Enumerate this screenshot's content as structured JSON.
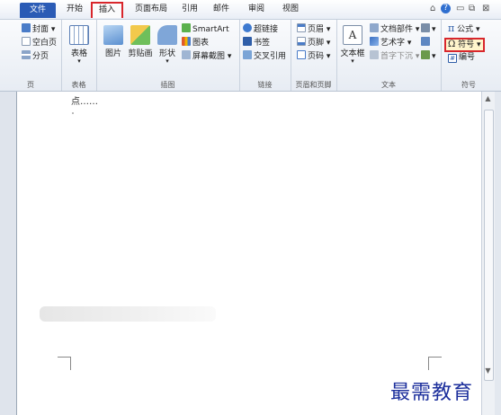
{
  "tabs": {
    "file": "文件",
    "home": "开始",
    "insert": "插入",
    "layout": "页面布局",
    "references": "引用",
    "mailings": "邮件",
    "review": "审阅",
    "view": "视图"
  },
  "window": {
    "help": "?",
    "minimize": "▭",
    "restore": "⧉",
    "close": "⊠"
  },
  "pages_group": {
    "cover": "封面",
    "blank": "空白页",
    "break": "分页",
    "label": "页"
  },
  "table_group": {
    "table": "表格",
    "label": "表格"
  },
  "illustrations_group": {
    "picture": "图片",
    "clipart": "剪贴画",
    "shapes": "形状",
    "smartart": "SmartArt",
    "chart": "图表",
    "screenshot": "屏幕截图",
    "label": "插图"
  },
  "links_group": {
    "hyperlink": "超链接",
    "bookmark": "书签",
    "crossref": "交叉引用",
    "label": "链接"
  },
  "headerfooter_group": {
    "header": "页眉",
    "footer": "页脚",
    "pagenum": "页码",
    "label": "页眉和页脚"
  },
  "text_group": {
    "textbox": "文本框",
    "quickparts": "文档部件",
    "wordart": "艺术字",
    "dropcap": "首字下沉",
    "label": "文本"
  },
  "symbols_group": {
    "equation": "公式",
    "symbol": "符号",
    "number": "编号",
    "label": "符号"
  },
  "document": {
    "text": "点……"
  },
  "watermark": "最需教育"
}
